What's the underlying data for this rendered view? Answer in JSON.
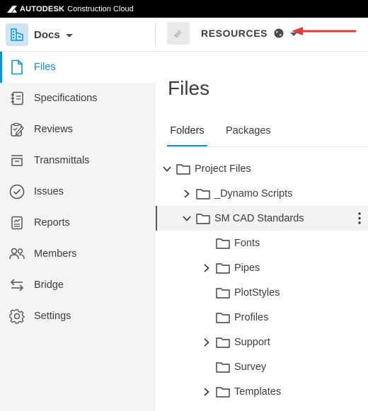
{
  "topbar": {
    "brand": "AUTODESK",
    "product": "Construction Cloud"
  },
  "header": {
    "app_name": "Docs",
    "project_name": "RESOURCES",
    "annotation_arrow_color": "#e03a3a"
  },
  "sidebar": {
    "items": [
      {
        "label": "Files",
        "icon": "file-icon",
        "active": true
      },
      {
        "label": "Specifications",
        "icon": "specifications-icon"
      },
      {
        "label": "Reviews",
        "icon": "reviews-icon"
      },
      {
        "label": "Transmittals",
        "icon": "transmittals-icon"
      },
      {
        "label": "Issues",
        "icon": "issues-icon"
      },
      {
        "label": "Reports",
        "icon": "reports-icon"
      },
      {
        "label": "Members",
        "icon": "members-icon"
      },
      {
        "label": "Bridge",
        "icon": "bridge-icon"
      },
      {
        "label": "Settings",
        "icon": "settings-icon"
      }
    ]
  },
  "main": {
    "title": "Files",
    "tabs": [
      {
        "label": "Folders",
        "active": true
      },
      {
        "label": "Packages"
      }
    ],
    "tree": [
      {
        "name": "Project Files",
        "level": 0,
        "state": "expanded"
      },
      {
        "name": "_Dynamo Scripts",
        "level": 1,
        "state": "collapsed"
      },
      {
        "name": "SM CAD Standards",
        "level": 1,
        "state": "expanded",
        "selected": true
      },
      {
        "name": "Fonts",
        "level": 2,
        "state": "leaf"
      },
      {
        "name": "Pipes",
        "level": 2,
        "state": "collapsed"
      },
      {
        "name": "PlotStyles",
        "level": 2,
        "state": "leaf"
      },
      {
        "name": "Profiles",
        "level": 2,
        "state": "leaf"
      },
      {
        "name": "Support",
        "level": 2,
        "state": "collapsed"
      },
      {
        "name": "Survey",
        "level": 2,
        "state": "leaf"
      },
      {
        "name": "Templates",
        "level": 2,
        "state": "collapsed"
      }
    ]
  },
  "colors": {
    "accent": "#0696d7",
    "sidebar_bg": "#f4f4f4",
    "topbar_bg": "#000000"
  }
}
